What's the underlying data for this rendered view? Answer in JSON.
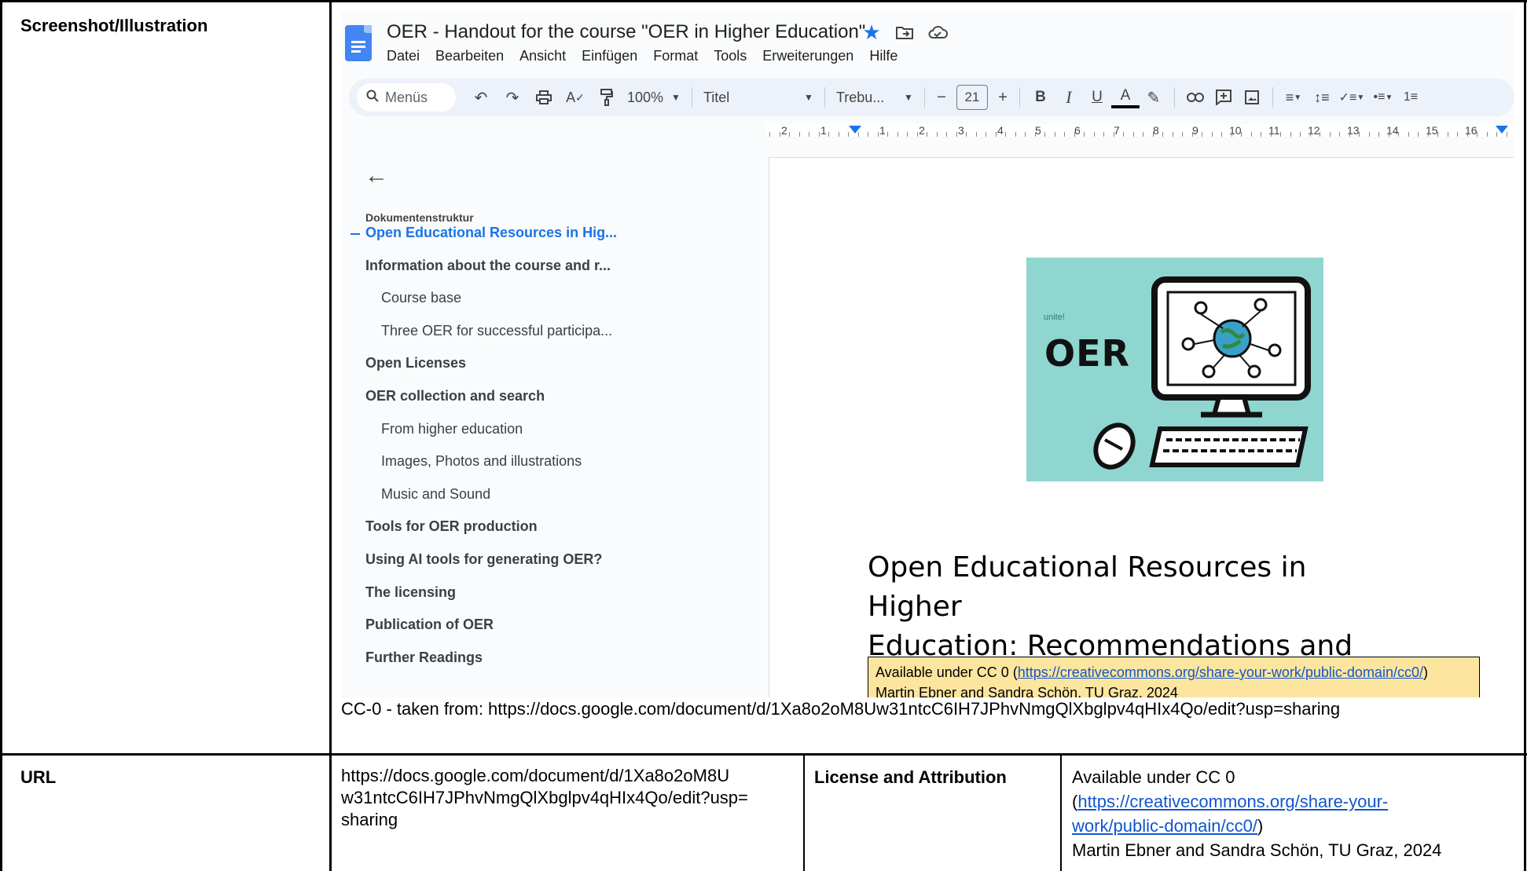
{
  "table": {
    "row1_label": "Screenshot/Illustration",
    "caption": "CC-0 - taken from: https://docs.google.com/document/d/1Xa8o2oM8Uw31ntcC6IH7JPhvNmgQlXbglpv4qHIx4Qo/edit?usp=sharing",
    "url_label": "URL",
    "url_lines": [
      "https://docs.google.com/document/d/1Xa8o2oM8U",
      "w31ntcC6IH7JPhvNmgQlXbglpv4qHIx4Qo/edit?usp=",
      "sharing"
    ],
    "license_label": "License and Attribution",
    "license_line1": "Available under CC 0",
    "license_paren_open": "(",
    "license_link_line1": "https://creativecommons.org/share-your-",
    "license_link_line2": "work/public-domain/cc0/",
    "license_paren_close": ")",
    "license_author": "Martin Ebner and Sandra Schön, TU Graz, 2024"
  },
  "gdocs": {
    "title": "OER - Handout for the course \"OER in Higher Education\"",
    "menu": [
      "Datei",
      "Bearbeiten",
      "Ansicht",
      "Einfügen",
      "Format",
      "Tools",
      "Erweiterungen",
      "Hilfe"
    ],
    "toolbar": {
      "search_placeholder": "Menüs",
      "zoom": "100%",
      "style": "Titel",
      "font": "Trebu...",
      "font_size": "21",
      "minus": "−",
      "plus": "+",
      "bold": "B",
      "italic": "I",
      "underline": "U",
      "text_color": "A"
    },
    "ruler_labels": [
      "2",
      "1",
      "1",
      "2",
      "3",
      "4",
      "5",
      "6",
      "7",
      "8",
      "9",
      "10",
      "11",
      "12",
      "13",
      "14",
      "15",
      "16"
    ],
    "outline": {
      "heading": "Dokumentenstruktur",
      "items": [
        {
          "label": "Open Educational Resources in Hig...",
          "level": 1,
          "active": true
        },
        {
          "label": "Information about the course and r...",
          "level": 1
        },
        {
          "label": "Course base",
          "level": 2
        },
        {
          "label": "Three OER for successful participa...",
          "level": 2
        },
        {
          "label": "Open Licenses",
          "level": 1
        },
        {
          "label": "OER collection and search",
          "level": 1
        },
        {
          "label": "From higher education",
          "level": 2
        },
        {
          "label": "Images, Photos and illustrations",
          "level": 2
        },
        {
          "label": "Music and Sound",
          "level": 2
        },
        {
          "label": "Tools for OER production",
          "level": 1
        },
        {
          "label": "Using AI tools for generating OER?",
          "level": 1
        },
        {
          "label": "The licensing",
          "level": 1
        },
        {
          "label": "Publication of OER",
          "level": 1
        },
        {
          "label": "Further Readings",
          "level": 1
        }
      ]
    },
    "page": {
      "image_text": "OER",
      "image_logo": "unite!",
      "title_line1": "Open Educational Resources in Higher",
      "title_line2": "Education: Recommendations and Links",
      "box_prefix": "Available under  CC 0 (",
      "box_link": "https://creativecommons.org/share-your-work/public-domain/cc0/",
      "box_suffix": ")",
      "box_author": "Martin Ebner and Sandra Schön, TU Graz, 2024"
    }
  },
  "colors": {
    "link": "#1155cc",
    "accent": "#1a73e8",
    "license_box": "#fce59e",
    "image_bg": "#8fd6d0"
  }
}
